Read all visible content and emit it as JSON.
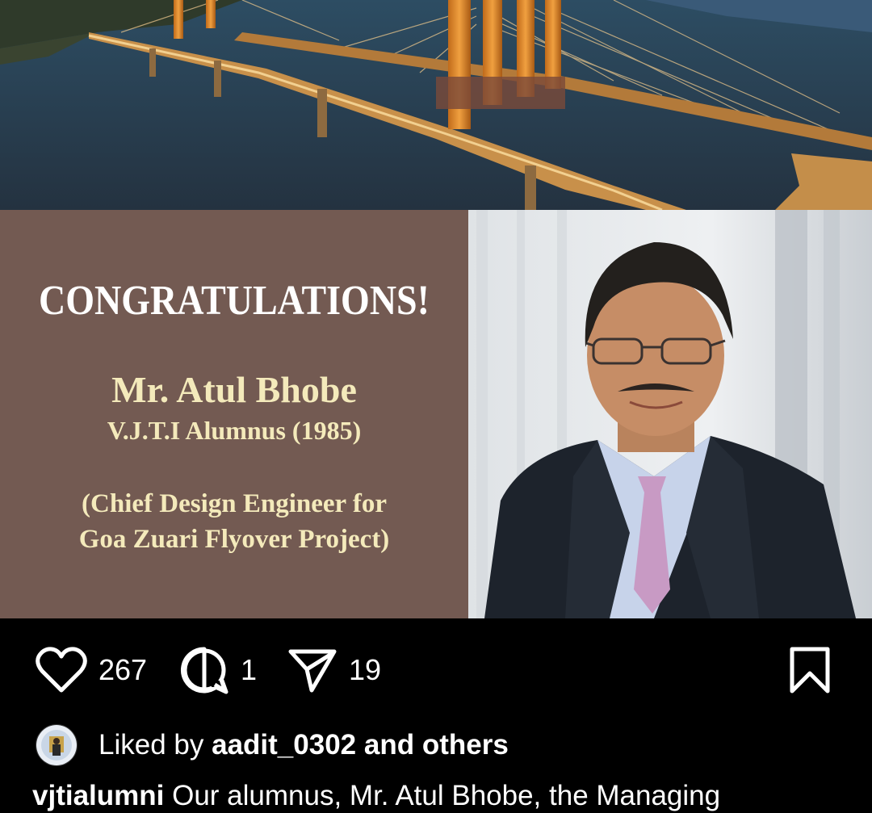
{
  "post": {
    "headline": "CONGRATULATIONS!",
    "person_name": "Mr. Atul Bhobe",
    "alumnus_line": "V.J.T.I Alumnus (1985)",
    "role_line1": "(Chief Design Engineer for",
    "role_line2": "Goa Zuari Flyover Project)"
  },
  "actions": {
    "likes": "267",
    "comments": "1",
    "shares": "19"
  },
  "liked_by": {
    "prefix": "Liked by",
    "user": "aadit_0302",
    "suffix": "and others"
  },
  "caption": {
    "username": "vjtialumni",
    "text": "Our alumnus, Mr. Atul Bhobe, the Managing"
  },
  "colors": {
    "panel": "#735a52",
    "name_text": "#f4eabb"
  },
  "icons": [
    "heart-icon",
    "comment-icon",
    "share-icon",
    "bookmark-icon"
  ]
}
